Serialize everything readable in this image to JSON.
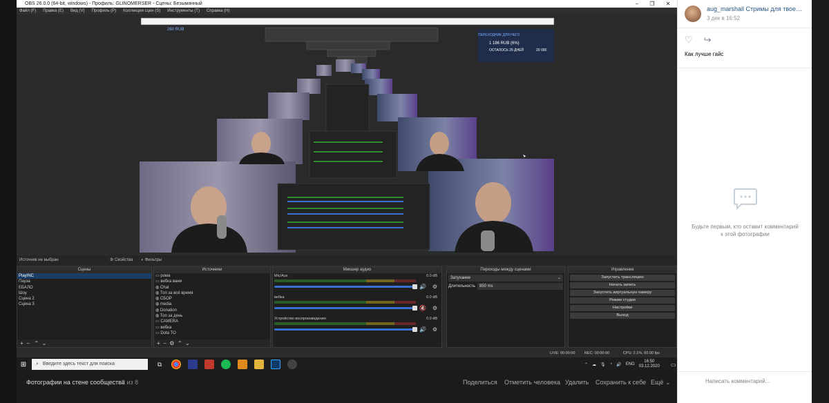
{
  "obs": {
    "title": "OBS 26.0.0 (64-bit, windows) - Профиль: GLINOMERSER - Сцены: Безымянный",
    "window_controls": [
      "–",
      "❐",
      "✕"
    ],
    "menu": [
      "Файл (F)",
      "Правка (E)",
      "Вид (V)",
      "Профиль (P)",
      "Коллекция сцен (S)",
      "Инструменты (T)",
      "Справка (H)"
    ],
    "preview_overlay": {
      "amount": "1 186 RUB (6%)",
      "days": "ОСТАЛОСЬ 29 ДНЕЙ",
      "goal": "20 000",
      "left_amount": "260 RUB",
      "top_caption": "ПЕРЕХОДНИК ДЛЯ НЕГО"
    },
    "source_bar": {
      "label": "Источник не выбран",
      "properties": "Свойства",
      "filters": "Фильтры"
    },
    "scenes": {
      "title": "Сцены",
      "items": [
        "PlayINC",
        "Пауза",
        "ЕБАЛО",
        "Шоу",
        "Сцена 2",
        "Сцена 3"
      ]
    },
    "sources": {
      "title": "Источники",
      "items": [
        "рома",
        "вебка вани",
        "Chat",
        "Топ за всё время",
        "СБОР",
        "media",
        "Donation",
        "Топ за день",
        "CAMERA",
        "вебка",
        "Dota TO"
      ]
    },
    "mixer": {
      "title": "Микшер аудио",
      "channels": [
        {
          "name": "Mic/Aux",
          "db": "0.0 dB",
          "muted": false
        },
        {
          "name": "вебка",
          "db": "0.0 dB",
          "muted": true
        },
        {
          "name": "Устройство воспроизведения",
          "db": "0.0 dB",
          "muted": false
        }
      ]
    },
    "transitions": {
      "title": "Переходы между сценами",
      "type": "Затухание",
      "duration_label": "Длительность",
      "duration_value": "850 ms"
    },
    "controls": {
      "title": "Управление",
      "buttons": [
        "Запустить трансляцию",
        "Начать запись",
        "Запустить виртуальную камеру",
        "Режим студии",
        "Настройки",
        "Выход"
      ]
    },
    "status": {
      "live": "LIVE: 00:00:00",
      "rec": "REC: 00:00:00",
      "cpu": "CPU: 2.1%, 60.00 fps"
    }
  },
  "taskbar": {
    "search_placeholder": "Введите здесь текст для поиска",
    "lang": "ENG",
    "time": "16:50",
    "date": "03.12.2020"
  },
  "gallery": {
    "caption": "Фотографии на стене сообщества",
    "counter": "2 из 8",
    "actions": [
      "Поделиться",
      "Отметить человека",
      "Удалить",
      "Сохранить к себе",
      "Ещё"
    ]
  },
  "post": {
    "author": "aug_marshall Стримы для твоей ду...",
    "date": "3 дек в 16:52",
    "text": "Как лучше гайс",
    "empty_comments": "Будьте первым, кто оставит комментарий к этой фотографии",
    "comment_placeholder": "Написать комментарий..."
  }
}
